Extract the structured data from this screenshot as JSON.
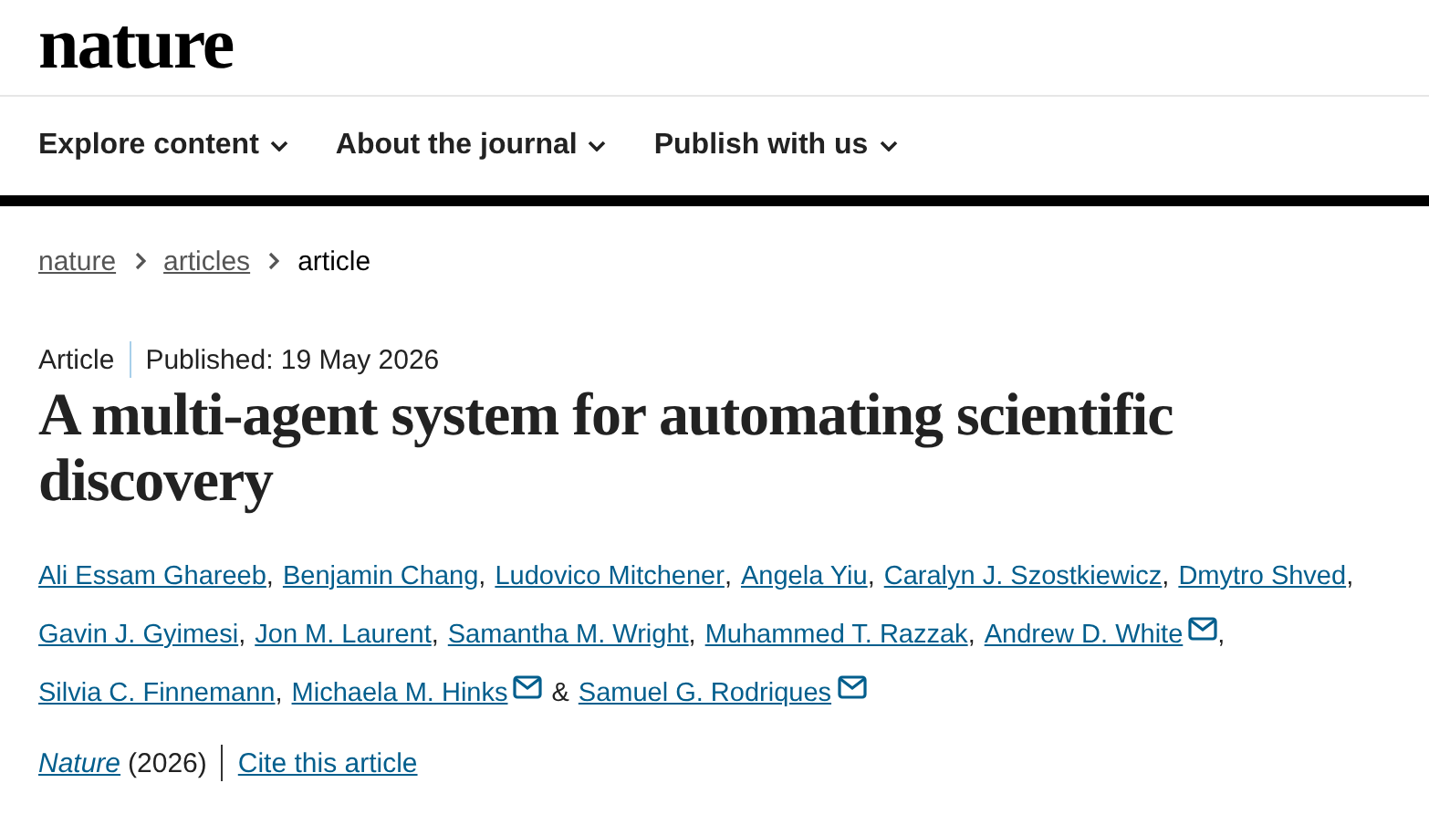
{
  "logo": "nature",
  "nav": [
    {
      "label": "Explore content"
    },
    {
      "label": "About the journal"
    },
    {
      "label": "Publish with us"
    }
  ],
  "breadcrumbs": [
    {
      "label": "nature",
      "link": true
    },
    {
      "label": "articles",
      "link": true
    },
    {
      "label": "article",
      "link": false
    }
  ],
  "article_type": "Article",
  "published": "Published: 19 May 2026",
  "title": "A multi-agent system for automating scientific discovery",
  "authors": [
    {
      "name": "Ali Essam Ghareeb",
      "email": false,
      "separator": ","
    },
    {
      "name": "Benjamin Chang",
      "email": false,
      "separator": ","
    },
    {
      "name": "Ludovico Mitchener",
      "email": false,
      "separator": ","
    },
    {
      "name": "Angela Yiu",
      "email": false,
      "separator": ","
    },
    {
      "name": "Caralyn J. Szostkiewicz",
      "email": false,
      "separator": ","
    },
    {
      "name": "Dmytro Shved",
      "email": false,
      "separator": ","
    },
    {
      "name": "Gavin J. Gyimesi",
      "email": false,
      "separator": ","
    },
    {
      "name": "Jon M. Laurent",
      "email": false,
      "separator": ","
    },
    {
      "name": "Samantha M. Wright",
      "email": false,
      "separator": ","
    },
    {
      "name": "Muhammed T. Razzak",
      "email": false,
      "separator": ","
    },
    {
      "name": "Andrew D. White",
      "email": true,
      "separator": ","
    },
    {
      "name": "Silvia C. Finnemann",
      "email": false,
      "separator": ","
    },
    {
      "name": "Michaela M. Hinks",
      "email": true,
      "separator": "&"
    },
    {
      "name": "Samuel G. Rodriques",
      "email": true
    }
  ],
  "journal": "Nature",
  "year": "(2026)",
  "cite": "Cite this article"
}
